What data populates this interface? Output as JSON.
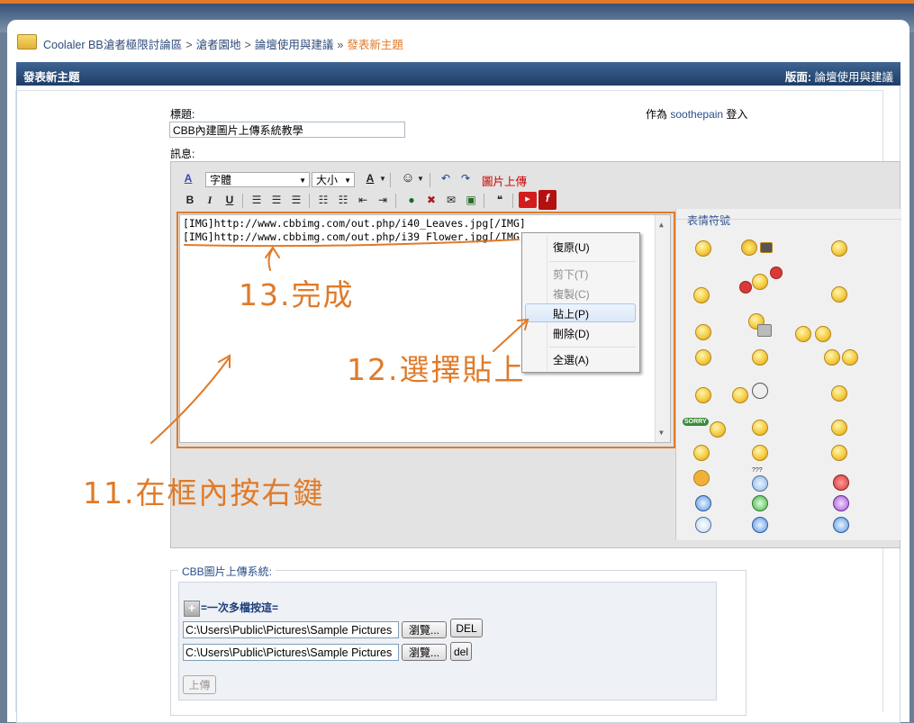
{
  "breadcrumb": {
    "items": [
      "Coolaler BB滄者極限討論區",
      "滄者園地",
      "論壇使用與建議"
    ],
    "separator": ">",
    "current_separator": "»",
    "current": "發表新主題"
  },
  "header": {
    "title": "發表新主題",
    "forum_prefix": "版面:",
    "forum_name": "論壇使用與建議"
  },
  "form": {
    "subject_label": "標題:",
    "subject_value": "CBB內建圖片上傳系統教學",
    "message_label": "訊息:",
    "login_prefix": "作為",
    "login_user": "soothepain",
    "login_suffix": "登入"
  },
  "toolbar": {
    "font_select": "字體",
    "size_select": "大小",
    "color_label": "A",
    "image_upload": "圖片上傳",
    "bold": "B",
    "italic": "I",
    "underline": "U"
  },
  "message_text": [
    "[IMG]http://www.cbbimg.com/out.php/i40_Leaves.jpg[/IMG]",
    "[IMG]http://www.cbbimg.com/out.php/i39_Flower.jpg[/IMG]"
  ],
  "context_menu": {
    "undo": "復原(U)",
    "cut": "剪下(T)",
    "copy": "複製(C)",
    "paste": "貼上(P)",
    "delete": "刪除(D)",
    "select_all": "全選(A)"
  },
  "emoticons": {
    "title": "表情符號",
    "sorry_label": "SORRY",
    "question_mark": "???"
  },
  "annotations": {
    "step11": "11.在框內按右鍵",
    "step12": "12.選擇貼上",
    "step13": "13.完成",
    "color": "#e07a28"
  },
  "upload": {
    "legend": "CBB圖片上傳系統:",
    "multi_label": "=一次多檔按這=",
    "files": [
      {
        "path": "C:\\Users\\Public\\Pictures\\Sample Pictures",
        "browse": "瀏覽...",
        "del": "DEL"
      },
      {
        "path": "C:\\Users\\Public\\Pictures\\Sample Pictures",
        "browse": "瀏覽...",
        "del": "del"
      }
    ],
    "upload_button": "上傳"
  },
  "colors": {
    "header_bar": "#1e3d66",
    "link": "#2a4f8c",
    "current_crumb": "#e07a28",
    "upload_link": "#cc0000"
  }
}
